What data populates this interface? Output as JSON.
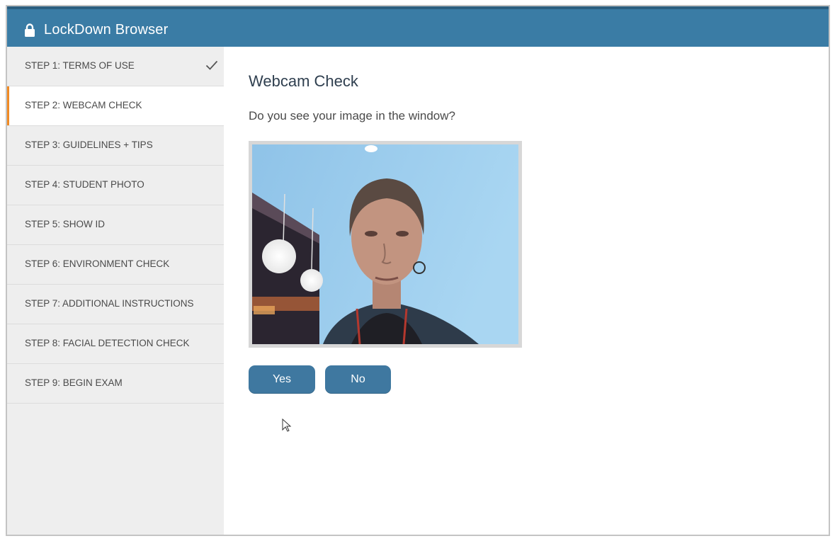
{
  "app": {
    "title": "LockDown Browser",
    "accent_color": "#3a7ca5",
    "active_marker_color": "#f08a24",
    "title_icon": "lock-icon"
  },
  "sidebar": {
    "items": [
      {
        "label": "STEP 1: TERMS OF USE",
        "completed": true,
        "active": false
      },
      {
        "label": "STEP 2: WEBCAM CHECK",
        "completed": false,
        "active": true
      },
      {
        "label": "STEP 3: GUIDELINES + TIPS",
        "completed": false,
        "active": false
      },
      {
        "label": "STEP 4: STUDENT PHOTO",
        "completed": false,
        "active": false
      },
      {
        "label": "STEP 5: SHOW ID",
        "completed": false,
        "active": false
      },
      {
        "label": "STEP 6: ENVIRONMENT CHECK",
        "completed": false,
        "active": false
      },
      {
        "label": "STEP 7: ADDITIONAL INSTRUCTIONS",
        "completed": false,
        "active": false
      },
      {
        "label": "STEP 8: FACIAL DETECTION CHECK",
        "completed": false,
        "active": false
      },
      {
        "label": "STEP 9: BEGIN EXAM",
        "completed": false,
        "active": false
      }
    ]
  },
  "main": {
    "heading": "Webcam Check",
    "question": "Do you see your image in the window?",
    "yes_label": "Yes",
    "no_label": "No",
    "button_color": "#3f78a0"
  }
}
